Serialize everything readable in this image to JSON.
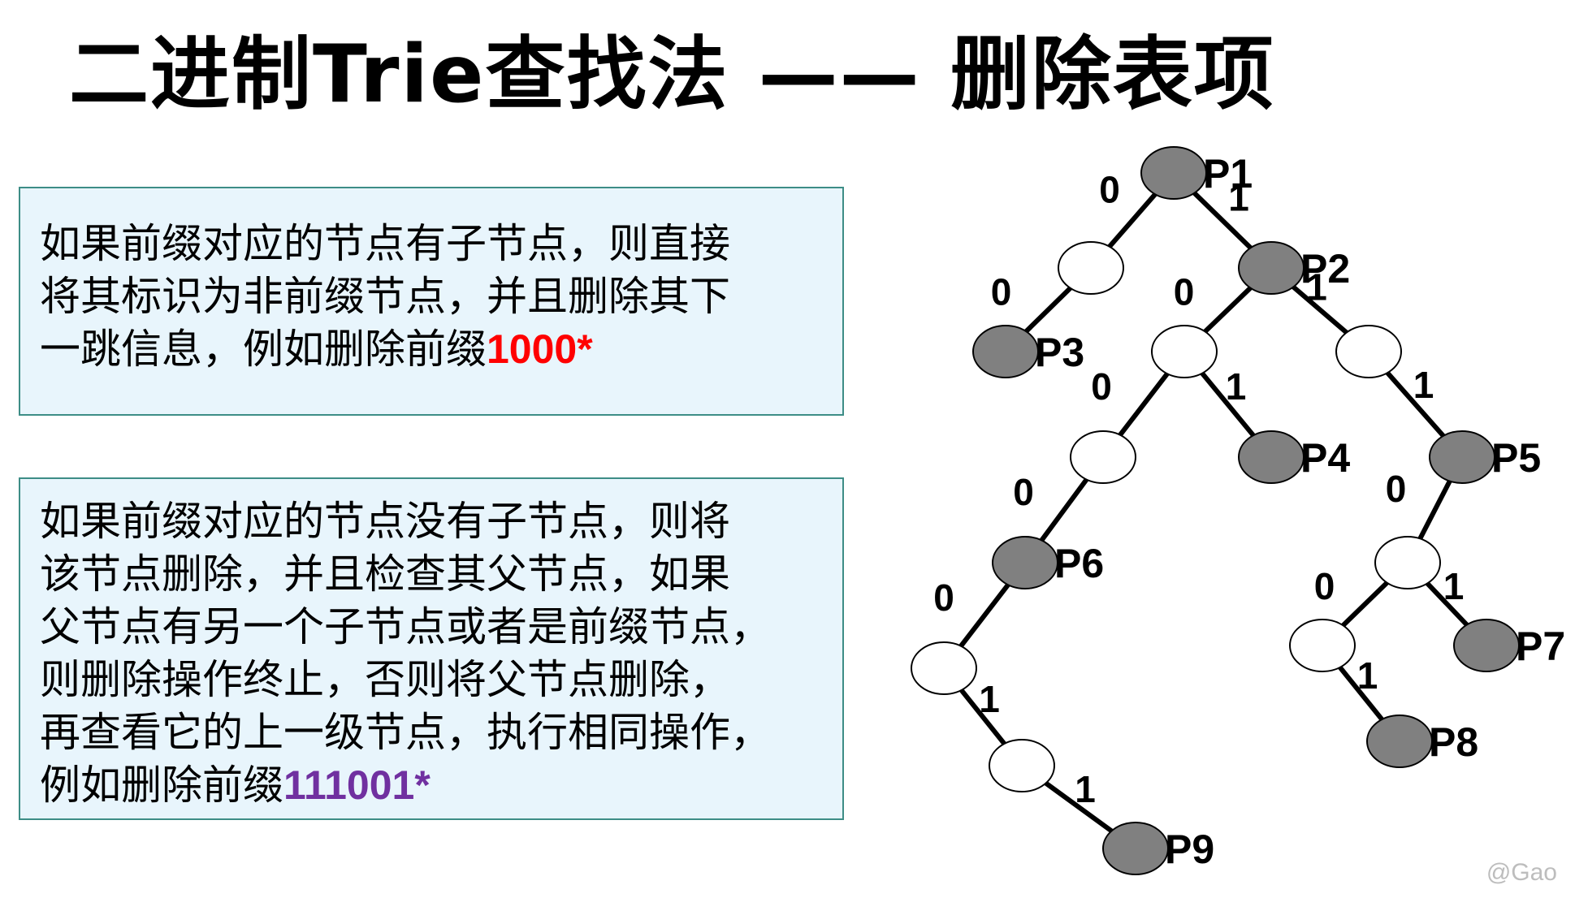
{
  "title": "二进制Trie查找法 —— 删除表项",
  "box1": {
    "lines": [
      "如果前缀对应的节点有子节点，则直接",
      "将其标识为非前缀节点，并且删除其下"
    ],
    "last_line_prefix": "一跳信息，例如删除前缀",
    "highlight": "1000*",
    "highlight_color": "#ff0000"
  },
  "box2": {
    "lines": [
      "如果前缀对应的节点没有子节点，则将",
      "该节点删除，并且检查其父节点，如果",
      "父节点有另一个子节点或者是前缀节点，",
      "则删除操作终止，否则将父节点删除，",
      "再查看它的上一级节点，执行相同操作，"
    ],
    "last_line_prefix": "例如删除前缀",
    "highlight": "111001*",
    "highlight_color": "#7030a0"
  },
  "tree": {
    "prefix_node_color": "#808080",
    "plain_node_color": "#ffffff",
    "nodes": [
      {
        "id": "root",
        "prefix": true,
        "label": "P1"
      },
      {
        "id": "n0",
        "prefix": false,
        "label": ""
      },
      {
        "id": "n1",
        "prefix": true,
        "label": "P2"
      },
      {
        "id": "n00",
        "prefix": true,
        "label": "P3"
      },
      {
        "id": "n10",
        "prefix": false,
        "label": ""
      },
      {
        "id": "n11",
        "prefix": false,
        "label": ""
      },
      {
        "id": "n100",
        "prefix": false,
        "label": ""
      },
      {
        "id": "n101",
        "prefix": true,
        "label": "P4"
      },
      {
        "id": "n111",
        "prefix": true,
        "label": "P5"
      },
      {
        "id": "n1000",
        "prefix": true,
        "label": "P6"
      },
      {
        "id": "n1110",
        "prefix": false,
        "label": ""
      },
      {
        "id": "n10000",
        "prefix": false,
        "label": ""
      },
      {
        "id": "n11100",
        "prefix": false,
        "label": ""
      },
      {
        "id": "n11101",
        "prefix": true,
        "label": "P7"
      },
      {
        "id": "n100001",
        "prefix": false,
        "label": ""
      },
      {
        "id": "n111001",
        "prefix": true,
        "label": "P8"
      },
      {
        "id": "n1000011",
        "prefix": true,
        "label": "P9"
      }
    ],
    "edges": [
      {
        "from": "root",
        "to": "n0",
        "bit": "0"
      },
      {
        "from": "root",
        "to": "n1",
        "bit": "1"
      },
      {
        "from": "n0",
        "to": "n00",
        "bit": "0"
      },
      {
        "from": "n1",
        "to": "n10",
        "bit": "0"
      },
      {
        "from": "n1",
        "to": "n11",
        "bit": "1"
      },
      {
        "from": "n10",
        "to": "n100",
        "bit": "0"
      },
      {
        "from": "n10",
        "to": "n101",
        "bit": "1"
      },
      {
        "from": "n11",
        "to": "n111",
        "bit": "1"
      },
      {
        "from": "n100",
        "to": "n1000",
        "bit": "0"
      },
      {
        "from": "n111",
        "to": "n1110",
        "bit": "0"
      },
      {
        "from": "n1000",
        "to": "n10000",
        "bit": "0"
      },
      {
        "from": "n1110",
        "to": "n11100",
        "bit": "0"
      },
      {
        "from": "n1110",
        "to": "n11101",
        "bit": "1"
      },
      {
        "from": "n10000",
        "to": "n100001",
        "bit": "1"
      },
      {
        "from": "n11100",
        "to": "n111001",
        "bit": "1"
      },
      {
        "from": "n100001",
        "to": "n1000011",
        "bit": "1"
      }
    ]
  },
  "watermark": "@Gao"
}
